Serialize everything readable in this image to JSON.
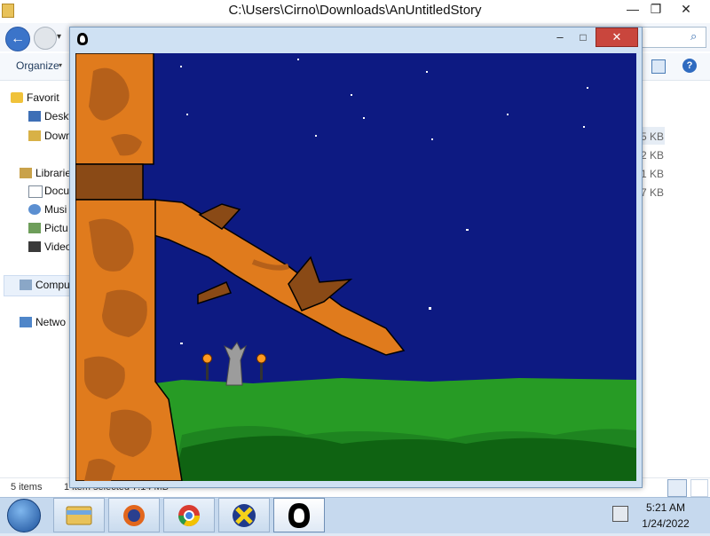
{
  "explorer": {
    "title": "C:\\Users\\Cirno\\Downloads\\AnUntitledStory",
    "caption_buttons": {
      "minimize": "—",
      "maximize": "❐",
      "close": "✕"
    },
    "nav": {
      "back": "←",
      "history": "▾"
    },
    "search_icon": "⌕",
    "command_bar": {
      "organize": "Organize",
      "organize_caret": "▾",
      "help": "?"
    },
    "nav_pane": {
      "favorites": "Favorit",
      "desktop": "Deskt",
      "downloads": "Down",
      "libraries": "Librarie",
      "documents": "Docu",
      "music": "Musi",
      "pictures": "Pictu",
      "videos": "Video",
      "computer": "Compu",
      "network": "Netwo"
    },
    "sizes": [
      "5 KB",
      "2 KB",
      "1 KB",
      "7 KB"
    ],
    "status": {
      "items": "5 items",
      "selected": "1 item selected  7.14 MB"
    }
  },
  "game_window": {
    "caption_buttons": {
      "minimize": "–",
      "maximize": "□",
      "close": "✕"
    },
    "colors": {
      "sky": "#0d1a82",
      "tree_light": "#e07b1d",
      "tree_dark": "#b5601a",
      "branch_dark": "#8a4a16",
      "grass_light": "#279b25",
      "grass_mid": "#1e8420",
      "grass_dark": "#0f6312",
      "statue": "#9c9c9c",
      "torch_flame": "#ff9a1f"
    },
    "scene_objects": [
      "tree-trunk",
      "tree-branch",
      "statue",
      "torch-left",
      "torch-right",
      "grass-hill",
      "stars"
    ]
  },
  "taskbar": {
    "start": "start-icon",
    "apps": [
      "file-explorer-icon",
      "firefox-icon",
      "chrome-icon",
      "xenia-icon",
      "game-icon"
    ],
    "clock_time": "5:21 AM",
    "clock_date": "1/24/2022"
  }
}
